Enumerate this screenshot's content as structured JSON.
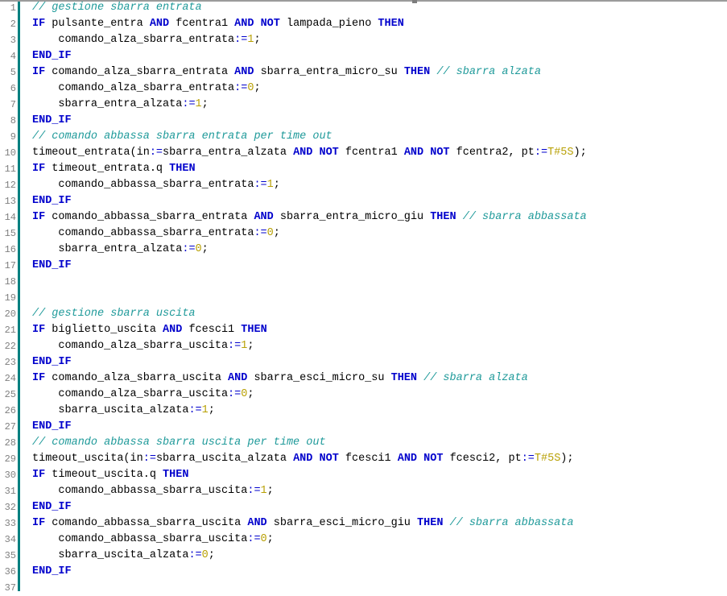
{
  "editor": {
    "name": "structured-text-code-editor",
    "language": "Structured Text (IEC 61131-3)",
    "colors": {
      "background": "#ffffff",
      "keyword": "#0000cc",
      "comment": "#1f9a9a",
      "number": "#b8a005",
      "operator": "#0000cc",
      "identifier": "#000000",
      "line_number": "#808080",
      "gutter_separator": "#008080",
      "top_rule": "#9b9b9b"
    },
    "line_numbers": [
      "1",
      "2",
      "3",
      "4",
      "5",
      "6",
      "7",
      "8",
      "9",
      "10",
      "11",
      "12",
      "13",
      "14",
      "15",
      "16",
      "17",
      "18",
      "19",
      "20",
      "21",
      "22",
      "23",
      "24",
      "25",
      "26",
      "27",
      "28",
      "29",
      "30",
      "31",
      "32",
      "33",
      "34",
      "35",
      "36",
      "37"
    ],
    "lines": [
      {
        "n": "1",
        "tokens": [
          {
            "t": "comment",
            "v": "// gestione sbarra entrata"
          }
        ]
      },
      {
        "n": "2",
        "tokens": [
          {
            "t": "kw",
            "v": "IF"
          },
          {
            "t": "plain",
            "v": " pulsante_entra "
          },
          {
            "t": "kw",
            "v": "AND"
          },
          {
            "t": "plain",
            "v": " fcentra1 "
          },
          {
            "t": "kw",
            "v": "AND"
          },
          {
            "t": "plain",
            "v": " "
          },
          {
            "t": "kw",
            "v": "NOT"
          },
          {
            "t": "plain",
            "v": " lampada_pieno "
          },
          {
            "t": "kw",
            "v": "THEN"
          }
        ]
      },
      {
        "n": "3",
        "tokens": [
          {
            "t": "plain",
            "v": "    comando_alza_sbarra_entrata"
          },
          {
            "t": "op",
            "v": ":="
          },
          {
            "t": "num",
            "v": "1"
          },
          {
            "t": "plain",
            "v": ";"
          }
        ]
      },
      {
        "n": "4",
        "tokens": [
          {
            "t": "kw",
            "v": "END_IF"
          }
        ]
      },
      {
        "n": "5",
        "tokens": [
          {
            "t": "kw",
            "v": "IF"
          },
          {
            "t": "plain",
            "v": " comando_alza_sbarra_entrata "
          },
          {
            "t": "kw",
            "v": "AND"
          },
          {
            "t": "plain",
            "v": " sbarra_entra_micro_su "
          },
          {
            "t": "kw",
            "v": "THEN"
          },
          {
            "t": "plain",
            "v": " "
          },
          {
            "t": "comment",
            "v": "// sbarra alzata"
          }
        ]
      },
      {
        "n": "6",
        "tokens": [
          {
            "t": "plain",
            "v": "    comando_alza_sbarra_entrata"
          },
          {
            "t": "op",
            "v": ":="
          },
          {
            "t": "num",
            "v": "0"
          },
          {
            "t": "plain",
            "v": ";"
          }
        ]
      },
      {
        "n": "7",
        "tokens": [
          {
            "t": "plain",
            "v": "    sbarra_entra_alzata"
          },
          {
            "t": "op",
            "v": ":="
          },
          {
            "t": "num",
            "v": "1"
          },
          {
            "t": "plain",
            "v": ";"
          }
        ]
      },
      {
        "n": "8",
        "tokens": [
          {
            "t": "kw",
            "v": "END_IF"
          }
        ]
      },
      {
        "n": "9",
        "tokens": [
          {
            "t": "comment",
            "v": "// comando abbassa sbarra entrata per time out"
          }
        ]
      },
      {
        "n": "10",
        "tokens": [
          {
            "t": "plain",
            "v": "timeout_entrata(in"
          },
          {
            "t": "op",
            "v": ":="
          },
          {
            "t": "plain",
            "v": "sbarra_entra_alzata "
          },
          {
            "t": "kw",
            "v": "AND"
          },
          {
            "t": "plain",
            "v": " "
          },
          {
            "t": "kw",
            "v": "NOT"
          },
          {
            "t": "plain",
            "v": " fcentra1 "
          },
          {
            "t": "kw",
            "v": "AND"
          },
          {
            "t": "plain",
            "v": " "
          },
          {
            "t": "kw",
            "v": "NOT"
          },
          {
            "t": "plain",
            "v": " fcentra2, pt"
          },
          {
            "t": "op",
            "v": ":="
          },
          {
            "t": "num",
            "v": "T#5S"
          },
          {
            "t": "plain",
            "v": ");"
          }
        ]
      },
      {
        "n": "11",
        "tokens": [
          {
            "t": "kw",
            "v": "IF"
          },
          {
            "t": "plain",
            "v": " timeout_entrata.q "
          },
          {
            "t": "kw",
            "v": "THEN"
          }
        ]
      },
      {
        "n": "12",
        "tokens": [
          {
            "t": "plain",
            "v": "    comando_abbassa_sbarra_entrata"
          },
          {
            "t": "op",
            "v": ":="
          },
          {
            "t": "num",
            "v": "1"
          },
          {
            "t": "plain",
            "v": ";"
          }
        ]
      },
      {
        "n": "13",
        "tokens": [
          {
            "t": "kw",
            "v": "END_IF"
          }
        ]
      },
      {
        "n": "14",
        "tokens": [
          {
            "t": "kw",
            "v": "IF"
          },
          {
            "t": "plain",
            "v": " comando_abbassa_sbarra_entrata "
          },
          {
            "t": "kw",
            "v": "AND"
          },
          {
            "t": "plain",
            "v": " sbarra_entra_micro_giu "
          },
          {
            "t": "kw",
            "v": "THEN"
          },
          {
            "t": "plain",
            "v": " "
          },
          {
            "t": "comment",
            "v": "// sbarra abbassata"
          }
        ]
      },
      {
        "n": "15",
        "tokens": [
          {
            "t": "plain",
            "v": "    comando_abbassa_sbarra_entrata"
          },
          {
            "t": "op",
            "v": ":="
          },
          {
            "t": "num",
            "v": "0"
          },
          {
            "t": "plain",
            "v": ";"
          }
        ]
      },
      {
        "n": "16",
        "tokens": [
          {
            "t": "plain",
            "v": "    sbarra_entra_alzata"
          },
          {
            "t": "op",
            "v": ":="
          },
          {
            "t": "num",
            "v": "0"
          },
          {
            "t": "plain",
            "v": ";"
          }
        ]
      },
      {
        "n": "17",
        "tokens": [
          {
            "t": "kw",
            "v": "END_IF"
          }
        ]
      },
      {
        "n": "18",
        "tokens": []
      },
      {
        "n": "19",
        "tokens": []
      },
      {
        "n": "20",
        "tokens": [
          {
            "t": "comment",
            "v": "// gestione sbarra uscita"
          }
        ]
      },
      {
        "n": "21",
        "tokens": [
          {
            "t": "kw",
            "v": "IF"
          },
          {
            "t": "plain",
            "v": " biglietto_uscita "
          },
          {
            "t": "kw",
            "v": "AND"
          },
          {
            "t": "plain",
            "v": " fcesci1 "
          },
          {
            "t": "kw",
            "v": "THEN"
          }
        ]
      },
      {
        "n": "22",
        "tokens": [
          {
            "t": "plain",
            "v": "    comando_alza_sbarra_uscita"
          },
          {
            "t": "op",
            "v": ":="
          },
          {
            "t": "num",
            "v": "1"
          },
          {
            "t": "plain",
            "v": ";"
          }
        ]
      },
      {
        "n": "23",
        "tokens": [
          {
            "t": "kw",
            "v": "END_IF"
          }
        ]
      },
      {
        "n": "24",
        "tokens": [
          {
            "t": "kw",
            "v": "IF"
          },
          {
            "t": "plain",
            "v": " comando_alza_sbarra_uscita "
          },
          {
            "t": "kw",
            "v": "AND"
          },
          {
            "t": "plain",
            "v": " sbarra_esci_micro_su "
          },
          {
            "t": "kw",
            "v": "THEN"
          },
          {
            "t": "plain",
            "v": " "
          },
          {
            "t": "comment",
            "v": "// sbarra alzata"
          }
        ]
      },
      {
        "n": "25",
        "tokens": [
          {
            "t": "plain",
            "v": "    comando_alza_sbarra_uscita"
          },
          {
            "t": "op",
            "v": ":="
          },
          {
            "t": "num",
            "v": "0"
          },
          {
            "t": "plain",
            "v": ";"
          }
        ]
      },
      {
        "n": "26",
        "tokens": [
          {
            "t": "plain",
            "v": "    sbarra_uscita_alzata"
          },
          {
            "t": "op",
            "v": ":="
          },
          {
            "t": "num",
            "v": "1"
          },
          {
            "t": "plain",
            "v": ";"
          }
        ]
      },
      {
        "n": "27",
        "tokens": [
          {
            "t": "kw",
            "v": "END_IF"
          }
        ]
      },
      {
        "n": "28",
        "tokens": [
          {
            "t": "comment",
            "v": "// comando abbassa sbarra uscita per time out"
          }
        ]
      },
      {
        "n": "29",
        "tokens": [
          {
            "t": "plain",
            "v": "timeout_uscita(in"
          },
          {
            "t": "op",
            "v": ":="
          },
          {
            "t": "plain",
            "v": "sbarra_uscita_alzata "
          },
          {
            "t": "kw",
            "v": "AND"
          },
          {
            "t": "plain",
            "v": " "
          },
          {
            "t": "kw",
            "v": "NOT"
          },
          {
            "t": "plain",
            "v": " fcesci1 "
          },
          {
            "t": "kw",
            "v": "AND"
          },
          {
            "t": "plain",
            "v": " "
          },
          {
            "t": "kw",
            "v": "NOT"
          },
          {
            "t": "plain",
            "v": " fcesci2, pt"
          },
          {
            "t": "op",
            "v": ":="
          },
          {
            "t": "num",
            "v": "T#5S"
          },
          {
            "t": "plain",
            "v": ");"
          }
        ]
      },
      {
        "n": "30",
        "tokens": [
          {
            "t": "kw",
            "v": "IF"
          },
          {
            "t": "plain",
            "v": " timeout_uscita.q "
          },
          {
            "t": "kw",
            "v": "THEN"
          }
        ]
      },
      {
        "n": "31",
        "tokens": [
          {
            "t": "plain",
            "v": "    comando_abbassa_sbarra_uscita"
          },
          {
            "t": "op",
            "v": ":="
          },
          {
            "t": "num",
            "v": "1"
          },
          {
            "t": "plain",
            "v": ";"
          }
        ]
      },
      {
        "n": "32",
        "tokens": [
          {
            "t": "kw",
            "v": "END_IF"
          }
        ]
      },
      {
        "n": "33",
        "tokens": [
          {
            "t": "kw",
            "v": "IF"
          },
          {
            "t": "plain",
            "v": " comando_abbassa_sbarra_uscita "
          },
          {
            "t": "kw",
            "v": "AND"
          },
          {
            "t": "plain",
            "v": " sbarra_esci_micro_giu "
          },
          {
            "t": "kw",
            "v": "THEN"
          },
          {
            "t": "plain",
            "v": " "
          },
          {
            "t": "comment",
            "v": "// sbarra abbassata"
          }
        ]
      },
      {
        "n": "34",
        "tokens": [
          {
            "t": "plain",
            "v": "    comando_abbassa_sbarra_uscita"
          },
          {
            "t": "op",
            "v": ":="
          },
          {
            "t": "num",
            "v": "0"
          },
          {
            "t": "plain",
            "v": ";"
          }
        ]
      },
      {
        "n": "35",
        "tokens": [
          {
            "t": "plain",
            "v": "    sbarra_uscita_alzata"
          },
          {
            "t": "op",
            "v": ":="
          },
          {
            "t": "num",
            "v": "0"
          },
          {
            "t": "plain",
            "v": ";"
          }
        ]
      },
      {
        "n": "36",
        "tokens": [
          {
            "t": "kw",
            "v": "END_IF"
          }
        ]
      },
      {
        "n": "37",
        "tokens": []
      }
    ]
  }
}
